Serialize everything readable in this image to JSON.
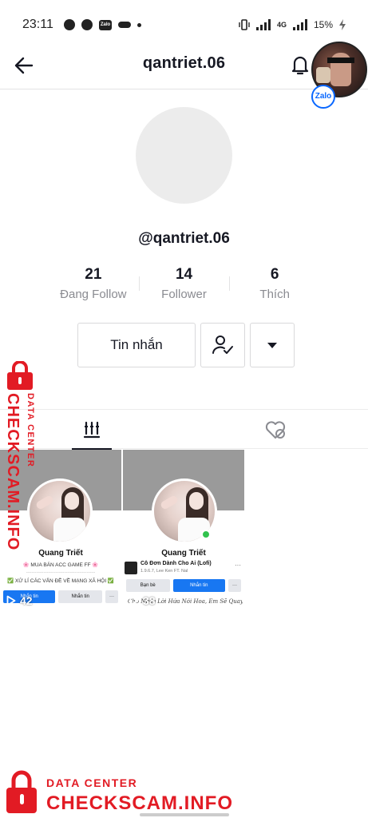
{
  "status_bar": {
    "time": "23:11",
    "left_icons": [
      "messenger-icon",
      "chat-bubble-icon",
      "zalo-icon",
      "key-icon",
      "dot-icon"
    ],
    "zalo_label": "Zalo",
    "network": "4G",
    "battery": "15%"
  },
  "header": {
    "title": "qantriet.06",
    "back_icon": "arrow-left-icon",
    "bell_icon": "bell-icon"
  },
  "zalo_bubble": {
    "badge_label": "Zalo"
  },
  "profile": {
    "handle": "@qantriet.06",
    "stats": [
      {
        "value": "21",
        "label": "Đang Follow"
      },
      {
        "value": "14",
        "label": "Follower"
      },
      {
        "value": "6",
        "label": "Thích"
      }
    ],
    "message_button": "Tin nhắn"
  },
  "tabs": [
    {
      "name": "videos",
      "icon": "grid-bars-icon",
      "active": true
    },
    {
      "name": "liked",
      "icon": "heart-hidden-icon",
      "active": false
    }
  ],
  "videos": [
    {
      "name": "Quang Triết",
      "line_a": "🌸 MUA BÁN ACC GAME FF 🌸",
      "line_b": "----------------------------------------",
      "line_c": "✅ XỬ LÍ CÁC VẤN ĐỀ VỀ MẠNG XÃ HỘI ✅",
      "btn_primary": "Nhắn tin",
      "btn_secondary": "Nhắn tin",
      "views": "42"
    },
    {
      "name": "Quang Triết",
      "song_title": "Cô Đơn Dành Cho Ai (Lofi)",
      "song_sub": "1.9.6.7, Lee Ken FT. Nal",
      "btn_secondary": "Bạn bè",
      "btn_primary": "Nhắn tin",
      "handwriting": "Cho Ngày Lời Hứa Nói Hoa, Em Sẽ Quay Lại",
      "views": "38"
    }
  ],
  "watermark": {
    "small": "DATA CENTER",
    "big": "CHECKSCAM.INFO",
    "color": "#e21b24"
  }
}
